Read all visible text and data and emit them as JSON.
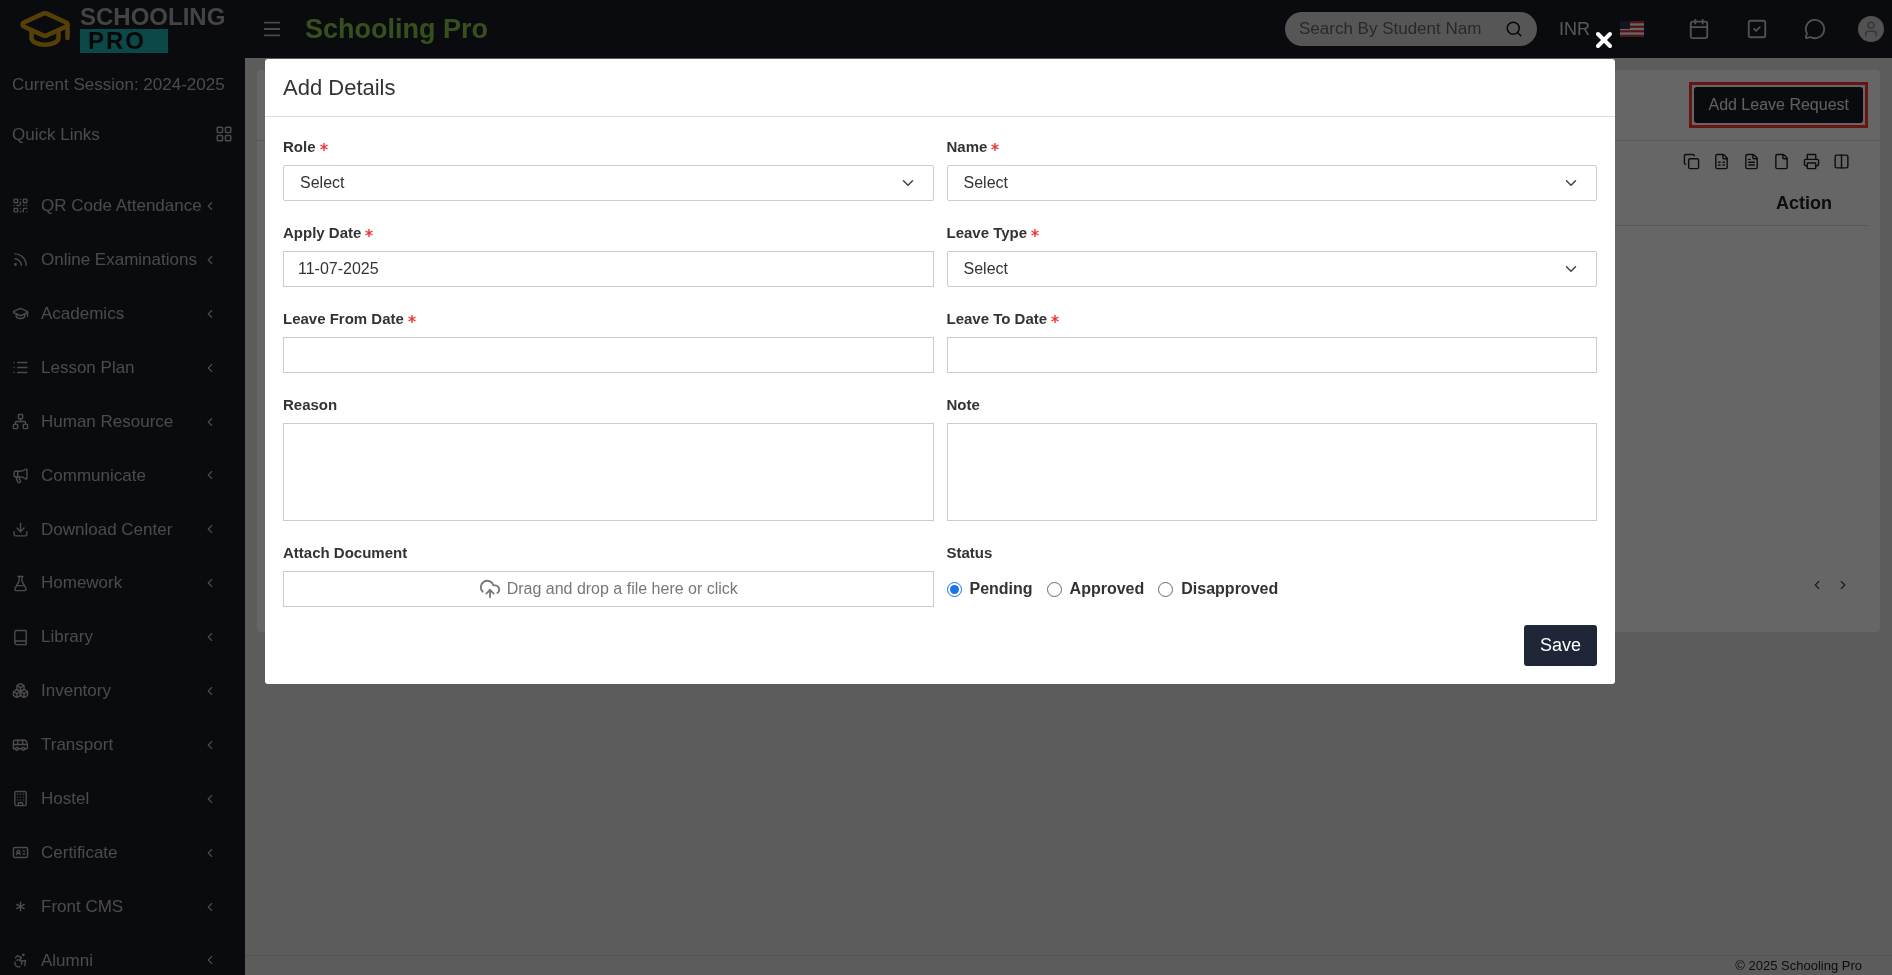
{
  "header": {
    "logo_top": "SCHOOLING",
    "logo_bottom": "PRO",
    "app_title": "Schooling Pro",
    "search": {
      "placeholder": "Search By Student Nam"
    },
    "currency": "INR"
  },
  "sidebar": {
    "session": "Current Session: 2024-2025",
    "quick_links": "Quick Links",
    "items": [
      {
        "label": "QR Code Attendance"
      },
      {
        "label": "Online Examinations"
      },
      {
        "label": "Academics"
      },
      {
        "label": "Lesson Plan"
      },
      {
        "label": "Human Resource"
      },
      {
        "label": "Communicate"
      },
      {
        "label": "Download Center"
      },
      {
        "label": "Homework"
      },
      {
        "label": "Library"
      },
      {
        "label": "Inventory"
      },
      {
        "label": "Transport"
      },
      {
        "label": "Hostel"
      },
      {
        "label": "Certificate"
      },
      {
        "label": "Front CMS"
      },
      {
        "label": "Alumni"
      }
    ]
  },
  "page": {
    "add_button": "Add Leave Request",
    "action_column": "Action",
    "footer": "© 2025 Schooling Pro"
  },
  "modal": {
    "title": "Add Details",
    "fields": [
      {
        "kind": "select",
        "label": "Role",
        "required": true,
        "value": "Select"
      },
      {
        "kind": "select",
        "label": "Name",
        "required": true,
        "value": "Select"
      },
      {
        "kind": "text",
        "label": "Apply Date",
        "required": true,
        "value": "11-07-2025"
      },
      {
        "kind": "select",
        "label": "Leave Type",
        "required": true,
        "value": "Select"
      },
      {
        "kind": "text",
        "label": "Leave From Date",
        "required": true
      },
      {
        "kind": "text",
        "label": "Leave To Date",
        "required": true
      },
      {
        "kind": "textarea",
        "label": "Reason",
        "required": false
      },
      {
        "kind": "textarea",
        "label": "Note",
        "required": false
      },
      {
        "kind": "file",
        "label": "Attach Document",
        "required": false,
        "placeholder": "Drag and drop a file here or click"
      },
      {
        "kind": "radio",
        "label": "Status",
        "required": false,
        "options": [
          {
            "label": "Pending",
            "selected": true
          },
          {
            "label": "Approved",
            "selected": false
          },
          {
            "label": "Disapproved",
            "selected": false
          }
        ]
      }
    ],
    "save": "Save"
  }
}
